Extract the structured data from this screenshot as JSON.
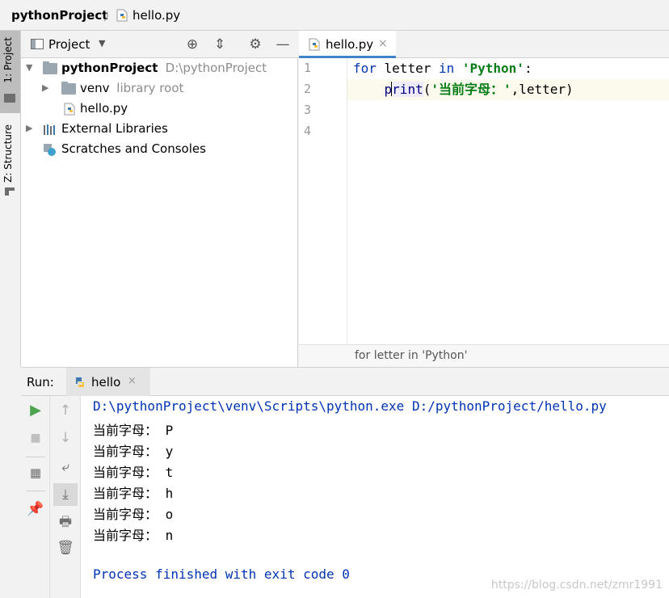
{
  "nav": {
    "project": "pythonProject",
    "separator": "〉",
    "file": "hello.py"
  },
  "left_strip": {
    "tab_project": "1: Project",
    "tab_structure": "Z: Structure"
  },
  "project_panel": {
    "title": "Project",
    "tree": [
      {
        "label": "pythonProject",
        "sub": "D:\\pythonProject"
      },
      {
        "label": "venv",
        "sub": "library root"
      },
      {
        "label": "hello.py",
        "sub": ""
      },
      {
        "label": "External Libraries",
        "sub": ""
      },
      {
        "label": "Scratches and Consoles",
        "sub": ""
      }
    ]
  },
  "editor": {
    "tab": "hello.py",
    "close": "×",
    "line_numbers": [
      "1",
      "2",
      "3",
      "4"
    ],
    "line1": {
      "kw_for": "for",
      "var": " letter ",
      "kw_in": "in",
      "str": "'Python'",
      "colon": ":"
    },
    "line2": {
      "indent": "    ",
      "fn_a": "p",
      "fn_b": "rint",
      "open": "(",
      "str": "'当前字母：'",
      "rest": ",letter)"
    },
    "breadcrumb": "for letter in 'Python'"
  },
  "run": {
    "label": "Run:",
    "tab": "hello",
    "close": "×",
    "console": {
      "command": "D:\\pythonProject\\venv\\Scripts\\python.exe D:/pythonProject/hello.py",
      "lines": [
        "当前字母： P",
        "当前字母： y",
        "当前字母： t",
        "当前字母： h",
        "当前字母： o",
        "当前字母： n"
      ],
      "exit": "Process finished with exit code 0"
    }
  },
  "watermark": "https://blog.csdn.net/zmr1991",
  "colors": {
    "accent": "#4083c9",
    "keyword": "#0033b3",
    "string": "#067d17",
    "current_line": "#fcfaed"
  }
}
